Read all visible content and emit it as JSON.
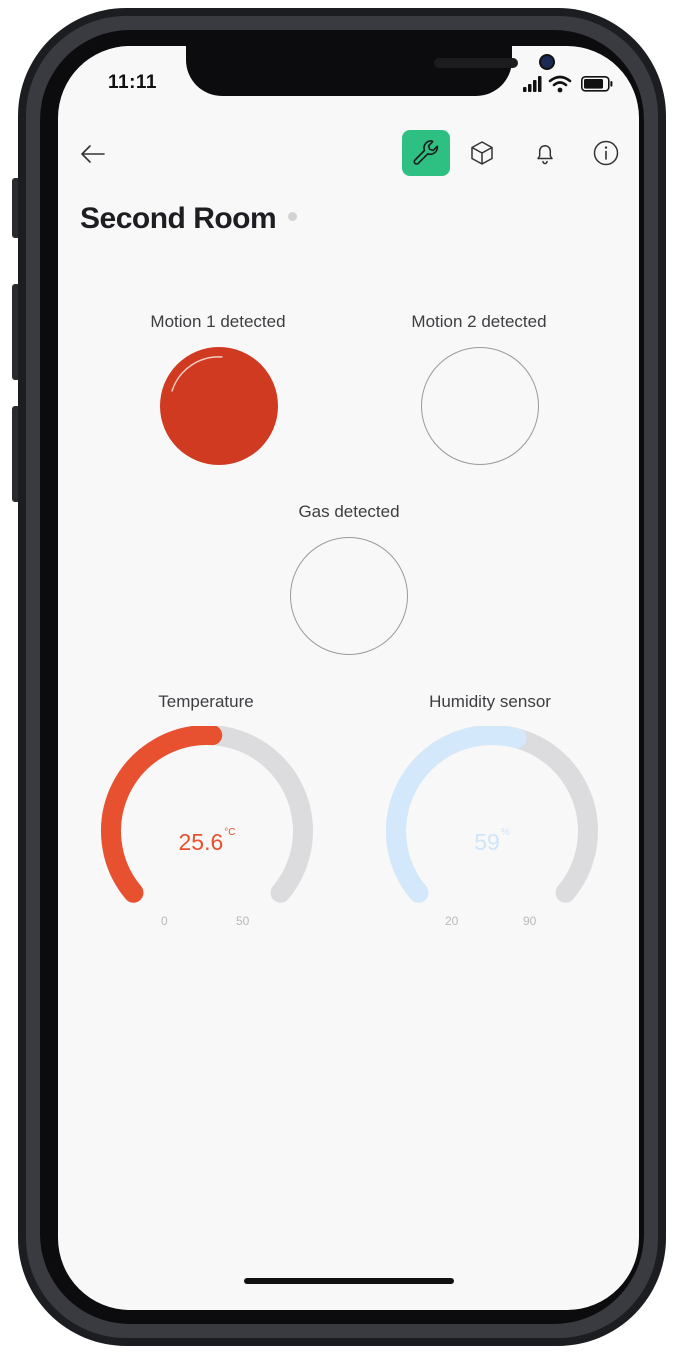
{
  "status_bar": {
    "time": "11:11"
  },
  "header": {
    "title": "Second Room"
  },
  "colors": {
    "accent": "#2ec082",
    "alarm_on": "#cf3a20",
    "temperature": "#e8512f",
    "humidity": "#d3e9fb",
    "track": "#dcdcdf"
  },
  "icons": {
    "back": "arrow-left-icon",
    "tool": "wrench-icon",
    "model": "cube-icon",
    "alerts": "bell-icon",
    "info": "info-icon"
  },
  "indicators": [
    {
      "label": "Motion 1 detected",
      "active": true
    },
    {
      "label": "Motion 2 detected",
      "active": false
    },
    {
      "label": "Gas detected",
      "active": false
    }
  ],
  "gauges": {
    "temperature": {
      "label": "Temperature",
      "value": "25.6",
      "unit": "°C",
      "min": "0",
      "max": "50",
      "fraction": 0.512
    },
    "humidity": {
      "label": "Humidity sensor",
      "value": "59",
      "unit": "%",
      "min": "20",
      "max": "90",
      "fraction": 0.557
    }
  }
}
